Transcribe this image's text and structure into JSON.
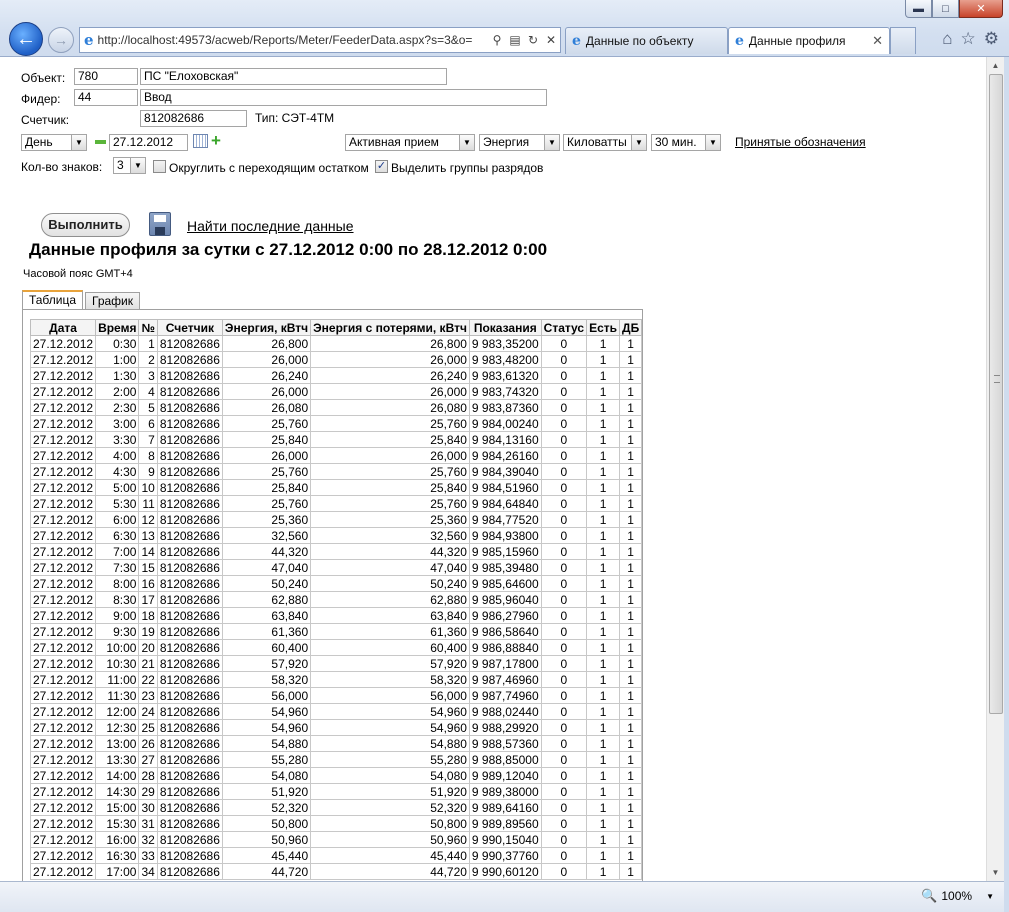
{
  "browser": {
    "url": "http://localhost:49573/acweb/Reports/Meter/FeederData.aspx?s=3&o=",
    "tabs": [
      {
        "label": "Данные по объекту",
        "active": false
      },
      {
        "label": "Данные профиля",
        "active": true
      }
    ],
    "zoom": "100%"
  },
  "form": {
    "object_label": "Объект:",
    "object_code": "780",
    "object_name": "ПС \"Елоховская\"",
    "feeder_label": "Фидер:",
    "feeder_code": "44",
    "feeder_name": "Ввод",
    "meter_label": "Счетчик:",
    "meter_value": "812082686",
    "type_label": "Тип: СЭТ-4ТМ",
    "period": "День",
    "date": "27.12.2012",
    "energy_type": "Активная прием",
    "quantity": "Энергия",
    "units": "Киловатты",
    "interval": "30 мин.",
    "legend_link": "Принятые обозначения",
    "digits_label": "Кол-во знаков:",
    "digits_value": "3",
    "round_label": "Округлить с переходящим остатком",
    "round_checked": false,
    "group_label": "Выделить группы разрядов",
    "group_checked": true
  },
  "actions": {
    "run_label": "Выполнить",
    "find_label": "Найти последние данные"
  },
  "report": {
    "title": "Данные профиля за сутки с 27.12.2012 0:00 по 28.12.2012 0:00",
    "timezone": "Часовой пояс GMT+4",
    "tabs": [
      "Таблица",
      "График"
    ]
  },
  "table": {
    "columns": [
      "Дата",
      "Время",
      "№",
      "Счетчик",
      "Энергия, кВтч",
      "Энергия с потерями, кВтч",
      "Показания",
      "Статус",
      "Есть",
      "ДБ"
    ],
    "rows": [
      [
        "27.12.2012",
        "0:30",
        "1",
        "812082686",
        "26,800",
        "26,800",
        "9 983,35200",
        "0",
        "1",
        "1"
      ],
      [
        "27.12.2012",
        "1:00",
        "2",
        "812082686",
        "26,000",
        "26,000",
        "9 983,48200",
        "0",
        "1",
        "1"
      ],
      [
        "27.12.2012",
        "1:30",
        "3",
        "812082686",
        "26,240",
        "26,240",
        "9 983,61320",
        "0",
        "1",
        "1"
      ],
      [
        "27.12.2012",
        "2:00",
        "4",
        "812082686",
        "26,000",
        "26,000",
        "9 983,74320",
        "0",
        "1",
        "1"
      ],
      [
        "27.12.2012",
        "2:30",
        "5",
        "812082686",
        "26,080",
        "26,080",
        "9 983,87360",
        "0",
        "1",
        "1"
      ],
      [
        "27.12.2012",
        "3:00",
        "6",
        "812082686",
        "25,760",
        "25,760",
        "9 984,00240",
        "0",
        "1",
        "1"
      ],
      [
        "27.12.2012",
        "3:30",
        "7",
        "812082686",
        "25,840",
        "25,840",
        "9 984,13160",
        "0",
        "1",
        "1"
      ],
      [
        "27.12.2012",
        "4:00",
        "8",
        "812082686",
        "26,000",
        "26,000",
        "9 984,26160",
        "0",
        "1",
        "1"
      ],
      [
        "27.12.2012",
        "4:30",
        "9",
        "812082686",
        "25,760",
        "25,760",
        "9 984,39040",
        "0",
        "1",
        "1"
      ],
      [
        "27.12.2012",
        "5:00",
        "10",
        "812082686",
        "25,840",
        "25,840",
        "9 984,51960",
        "0",
        "1",
        "1"
      ],
      [
        "27.12.2012",
        "5:30",
        "11",
        "812082686",
        "25,760",
        "25,760",
        "9 984,64840",
        "0",
        "1",
        "1"
      ],
      [
        "27.12.2012",
        "6:00",
        "12",
        "812082686",
        "25,360",
        "25,360",
        "9 984,77520",
        "0",
        "1",
        "1"
      ],
      [
        "27.12.2012",
        "6:30",
        "13",
        "812082686",
        "32,560",
        "32,560",
        "9 984,93800",
        "0",
        "1",
        "1"
      ],
      [
        "27.12.2012",
        "7:00",
        "14",
        "812082686",
        "44,320",
        "44,320",
        "9 985,15960",
        "0",
        "1",
        "1"
      ],
      [
        "27.12.2012",
        "7:30",
        "15",
        "812082686",
        "47,040",
        "47,040",
        "9 985,39480",
        "0",
        "1",
        "1"
      ],
      [
        "27.12.2012",
        "8:00",
        "16",
        "812082686",
        "50,240",
        "50,240",
        "9 985,64600",
        "0",
        "1",
        "1"
      ],
      [
        "27.12.2012",
        "8:30",
        "17",
        "812082686",
        "62,880",
        "62,880",
        "9 985,96040",
        "0",
        "1",
        "1"
      ],
      [
        "27.12.2012",
        "9:00",
        "18",
        "812082686",
        "63,840",
        "63,840",
        "9 986,27960",
        "0",
        "1",
        "1"
      ],
      [
        "27.12.2012",
        "9:30",
        "19",
        "812082686",
        "61,360",
        "61,360",
        "9 986,58640",
        "0",
        "1",
        "1"
      ],
      [
        "27.12.2012",
        "10:00",
        "20",
        "812082686",
        "60,400",
        "60,400",
        "9 986,88840",
        "0",
        "1",
        "1"
      ],
      [
        "27.12.2012",
        "10:30",
        "21",
        "812082686",
        "57,920",
        "57,920",
        "9 987,17800",
        "0",
        "1",
        "1"
      ],
      [
        "27.12.2012",
        "11:00",
        "22",
        "812082686",
        "58,320",
        "58,320",
        "9 987,46960",
        "0",
        "1",
        "1"
      ],
      [
        "27.12.2012",
        "11:30",
        "23",
        "812082686",
        "56,000",
        "56,000",
        "9 987,74960",
        "0",
        "1",
        "1"
      ],
      [
        "27.12.2012",
        "12:00",
        "24",
        "812082686",
        "54,960",
        "54,960",
        "9 988,02440",
        "0",
        "1",
        "1"
      ],
      [
        "27.12.2012",
        "12:30",
        "25",
        "812082686",
        "54,960",
        "54,960",
        "9 988,29920",
        "0",
        "1",
        "1"
      ],
      [
        "27.12.2012",
        "13:00",
        "26",
        "812082686",
        "54,880",
        "54,880",
        "9 988,57360",
        "0",
        "1",
        "1"
      ],
      [
        "27.12.2012",
        "13:30",
        "27",
        "812082686",
        "55,280",
        "55,280",
        "9 988,85000",
        "0",
        "1",
        "1"
      ],
      [
        "27.12.2012",
        "14:00",
        "28",
        "812082686",
        "54,080",
        "54,080",
        "9 989,12040",
        "0",
        "1",
        "1"
      ],
      [
        "27.12.2012",
        "14:30",
        "29",
        "812082686",
        "51,920",
        "51,920",
        "9 989,38000",
        "0",
        "1",
        "1"
      ],
      [
        "27.12.2012",
        "15:00",
        "30",
        "812082686",
        "52,320",
        "52,320",
        "9 989,64160",
        "0",
        "1",
        "1"
      ],
      [
        "27.12.2012",
        "15:30",
        "31",
        "812082686",
        "50,800",
        "50,800",
        "9 989,89560",
        "0",
        "1",
        "1"
      ],
      [
        "27.12.2012",
        "16:00",
        "32",
        "812082686",
        "50,960",
        "50,960",
        "9 990,15040",
        "0",
        "1",
        "1"
      ],
      [
        "27.12.2012",
        "16:30",
        "33",
        "812082686",
        "45,440",
        "45,440",
        "9 990,37760",
        "0",
        "1",
        "1"
      ],
      [
        "27.12.2012",
        "17:00",
        "34",
        "812082686",
        "44,720",
        "44,720",
        "9 990,60120",
        "0",
        "1",
        "1"
      ]
    ]
  }
}
